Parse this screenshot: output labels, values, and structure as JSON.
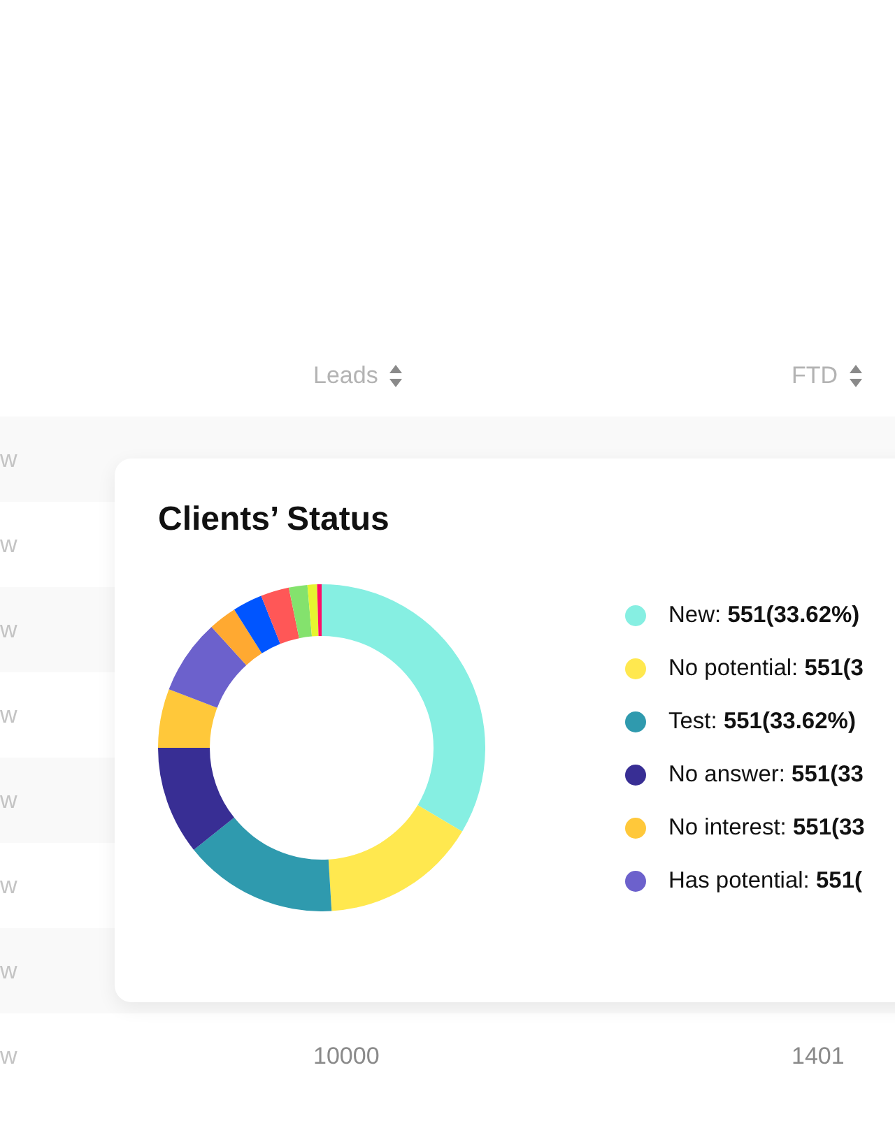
{
  "table": {
    "columns": [
      {
        "label": "Leads"
      },
      {
        "label": "FTD"
      }
    ],
    "rows": [
      {
        "column_1": "w"
      },
      {
        "column_1": "w"
      },
      {
        "column_1": "w"
      },
      {
        "column_1": "w"
      },
      {
        "column_1": "w"
      },
      {
        "column_1": "w"
      },
      {
        "column_1": "w"
      },
      {
        "column_1": "w",
        "leads": "10000",
        "ftd": "1401"
      }
    ]
  },
  "card": {
    "title": "Clients’ Status",
    "legend": [
      {
        "label": "New:",
        "value": "551(33.62%)",
        "color": "#86efe2"
      },
      {
        "label": "No potential:",
        "value": "551(3",
        "color": "#ffe84f"
      },
      {
        "label": "Test:",
        "value": "551(33.62%)",
        "color": "#2f9aae"
      },
      {
        "label": "No answer:",
        "value": "551(33",
        "color": "#382e94"
      },
      {
        "label": "No interest:",
        "value": "551(33",
        "color": "#ffc83a"
      },
      {
        "label": "Has potential:",
        "value": "551(",
        "color": "#6c61cc"
      }
    ]
  }
}
